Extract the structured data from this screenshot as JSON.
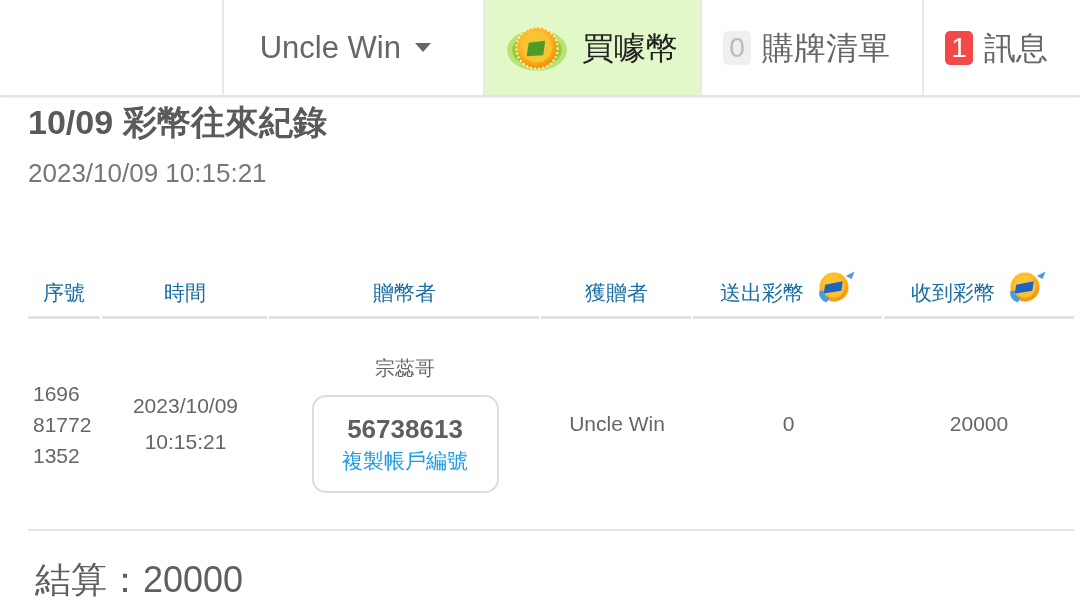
{
  "nav": {
    "items": [
      {
        "kind": "dropdown",
        "label": "Uncle Win",
        "selected": false
      },
      {
        "kind": "coin",
        "label": "買噱幣",
        "selected": true
      },
      {
        "kind": "badge",
        "label": "購牌清單",
        "selected": false,
        "badge": {
          "text": "0",
          "highlighted": false
        }
      },
      {
        "kind": "badge",
        "label": "訊息",
        "selected": false,
        "badge": {
          "text": "1",
          "highlighted": true
        }
      }
    ]
  },
  "title": "10/09 彩幣往來紀錄",
  "datetime": "2023/10/09 10:15:21",
  "table": {
    "columns": [
      {
        "label": "序號",
        "kind": "plain"
      },
      {
        "label": "時間",
        "kind": "plain"
      },
      {
        "label": "贈幣者",
        "kind": "plain"
      },
      {
        "label": "獲贈者",
        "kind": "plain"
      },
      {
        "label": "送出彩幣",
        "kind": "coin"
      },
      {
        "label": "收到彩幣",
        "kind": "coin"
      }
    ],
    "rows": [
      {
        "serial": "1696 81772 1352",
        "time": "2023/10/09 10:15:21",
        "giver": {
          "name": "宗蕊哥",
          "account": "56738613",
          "copy_link": "複製帳戶編號"
        },
        "receiver": "Uncle Win",
        "sent": "0",
        "received": "20000"
      }
    ]
  },
  "summary": "結算：20000"
}
